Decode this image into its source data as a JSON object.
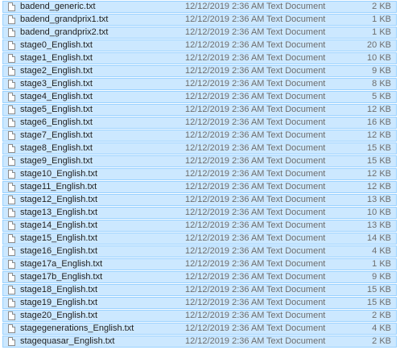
{
  "files": [
    {
      "name": "badend_generic.txt",
      "date": "12/12/2019 2:36 AM",
      "type": "Text Document",
      "size": "2 KB"
    },
    {
      "name": "badend_grandprix1.txt",
      "date": "12/12/2019 2:36 AM",
      "type": "Text Document",
      "size": "1 KB"
    },
    {
      "name": "badend_grandprix2.txt",
      "date": "12/12/2019 2:36 AM",
      "type": "Text Document",
      "size": "1 KB"
    },
    {
      "name": "stage0_English.txt",
      "date": "12/12/2019 2:36 AM",
      "type": "Text Document",
      "size": "20 KB"
    },
    {
      "name": "stage1_English.txt",
      "date": "12/12/2019 2:36 AM",
      "type": "Text Document",
      "size": "10 KB"
    },
    {
      "name": "stage2_English.txt",
      "date": "12/12/2019 2:36 AM",
      "type": "Text Document",
      "size": "9 KB"
    },
    {
      "name": "stage3_English.txt",
      "date": "12/12/2019 2:36 AM",
      "type": "Text Document",
      "size": "8 KB"
    },
    {
      "name": "stage4_English.txt",
      "date": "12/12/2019 2:36 AM",
      "type": "Text Document",
      "size": "5 KB"
    },
    {
      "name": "stage5_English.txt",
      "date": "12/12/2019 2:36 AM",
      "type": "Text Document",
      "size": "12 KB"
    },
    {
      "name": "stage6_English.txt",
      "date": "12/12/2019 2:36 AM",
      "type": "Text Document",
      "size": "16 KB"
    },
    {
      "name": "stage7_English.txt",
      "date": "12/12/2019 2:36 AM",
      "type": "Text Document",
      "size": "12 KB"
    },
    {
      "name": "stage8_English.txt",
      "date": "12/12/2019 2:36 AM",
      "type": "Text Document",
      "size": "15 KB"
    },
    {
      "name": "stage9_English.txt",
      "date": "12/12/2019 2:36 AM",
      "type": "Text Document",
      "size": "15 KB"
    },
    {
      "name": "stage10_English.txt",
      "date": "12/12/2019 2:36 AM",
      "type": "Text Document",
      "size": "12 KB"
    },
    {
      "name": "stage11_English.txt",
      "date": "12/12/2019 2:36 AM",
      "type": "Text Document",
      "size": "12 KB"
    },
    {
      "name": "stage12_English.txt",
      "date": "12/12/2019 2:36 AM",
      "type": "Text Document",
      "size": "13 KB"
    },
    {
      "name": "stage13_English.txt",
      "date": "12/12/2019 2:36 AM",
      "type": "Text Document",
      "size": "10 KB"
    },
    {
      "name": "stage14_English.txt",
      "date": "12/12/2019 2:36 AM",
      "type": "Text Document",
      "size": "13 KB"
    },
    {
      "name": "stage15_English.txt",
      "date": "12/12/2019 2:36 AM",
      "type": "Text Document",
      "size": "14 KB"
    },
    {
      "name": "stage16_English.txt",
      "date": "12/12/2019 2:36 AM",
      "type": "Text Document",
      "size": "4 KB"
    },
    {
      "name": "stage17a_English.txt",
      "date": "12/12/2019 2:36 AM",
      "type": "Text Document",
      "size": "1 KB"
    },
    {
      "name": "stage17b_English.txt",
      "date": "12/12/2019 2:36 AM",
      "type": "Text Document",
      "size": "9 KB"
    },
    {
      "name": "stage18_English.txt",
      "date": "12/12/2019 2:36 AM",
      "type": "Text Document",
      "size": "15 KB"
    },
    {
      "name": "stage19_English.txt",
      "date": "12/12/2019 2:36 AM",
      "type": "Text Document",
      "size": "15 KB"
    },
    {
      "name": "stage20_English.txt",
      "date": "12/12/2019 2:36 AM",
      "type": "Text Document",
      "size": "2 KB"
    },
    {
      "name": "stagegenerations_English.txt",
      "date": "12/12/2019 2:36 AM",
      "type": "Text Document",
      "size": "4 KB"
    },
    {
      "name": "stagequasar_English.txt",
      "date": "12/12/2019 2:36 AM",
      "type": "Text Document",
      "size": "2 KB"
    }
  ],
  "icons": {
    "file": "text-document-icon"
  },
  "colors": {
    "selection_fill": "#cce8ff",
    "selection_border": "#99d1ff",
    "secondary_text": "#6d6d6d"
  },
  "state": {
    "all_selected": "true"
  }
}
